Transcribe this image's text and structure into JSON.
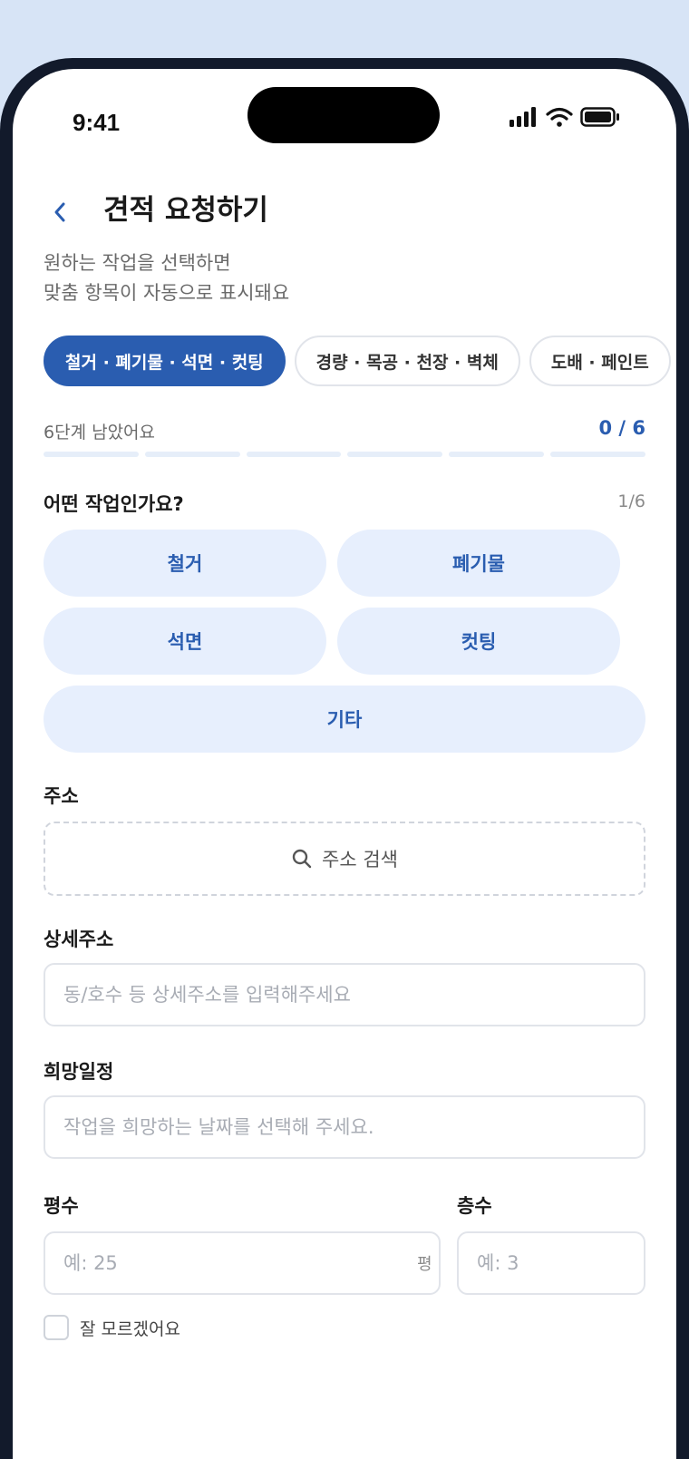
{
  "status_bar": {
    "time": "9:41"
  },
  "header": {
    "back_icon": "chevron-left-icon",
    "title": "견적 요청하기",
    "subtitle_lines": [
      "원하는 작업을 선택하면",
      "맞춤 항목이 자동으로 표시돼요"
    ]
  },
  "category_tabs": [
    {
      "label": "철거 · 폐기물 · 석면 · 컷팅",
      "active": true
    },
    {
      "label": "경량 · 목공 · 천장 · 벽체",
      "active": false
    },
    {
      "label": "도배 · 페인트",
      "active": false
    }
  ],
  "progress": {
    "remaining_text": "6단계 남았어요",
    "count_text": "0 / 6",
    "completed": 0,
    "total": 6
  },
  "question": {
    "title": "어떤 작업인가요?",
    "step": "1/6",
    "options": [
      "철거",
      "폐기물",
      "석면",
      "컷팅",
      "기타"
    ]
  },
  "address": {
    "label": "주소",
    "search_label": "주소 검색",
    "search_icon": "search-icon"
  },
  "detail_address": {
    "label": "상세주소",
    "placeholder": "동/호수 등 상세주소를 입력해주세요"
  },
  "schedule": {
    "label": "희망일정",
    "placeholder": "작업을 희망하는 날짜를 선택해 주세요."
  },
  "area": {
    "label": "평수",
    "placeholder": "예: 25",
    "unit": "평"
  },
  "floor": {
    "label": "층수",
    "placeholder": "예: 3"
  },
  "unknown_checkbox": {
    "label": "잘 모르겠어요",
    "checked": false
  },
  "colors": {
    "accent": "#2a5db0",
    "option_bg": "#e7effd"
  }
}
